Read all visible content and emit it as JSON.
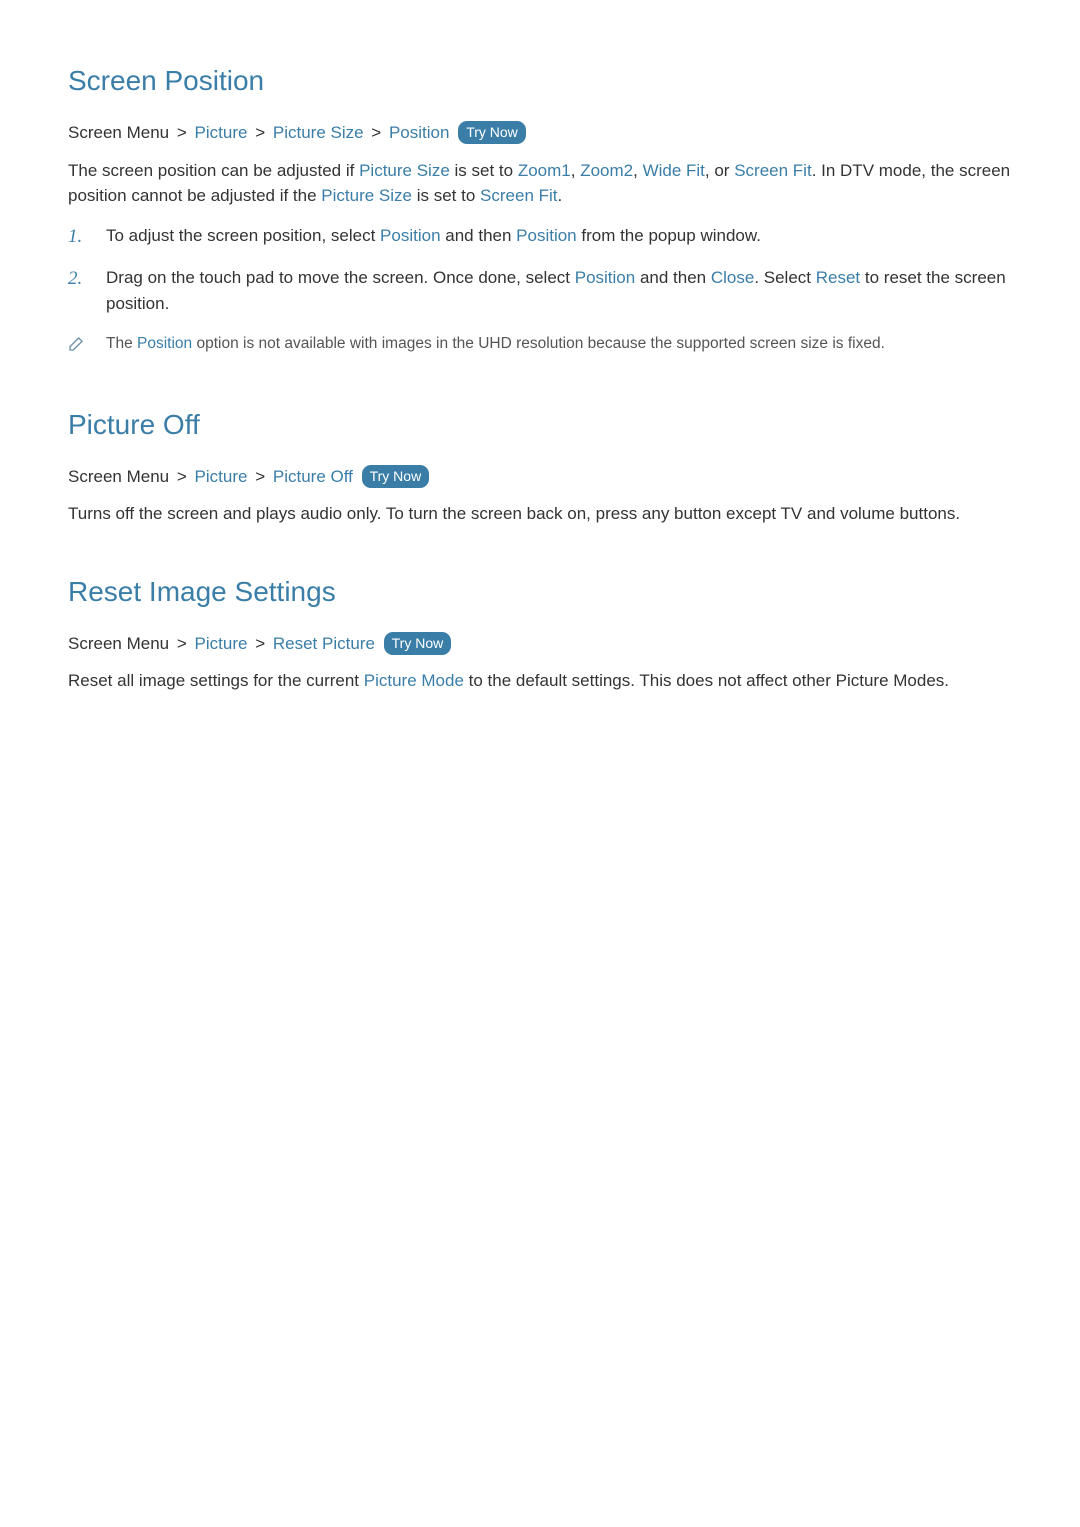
{
  "tryNowLabel": "Try Now",
  "sections": [
    {
      "title": "Screen Position",
      "breadcrumb": {
        "root": "Screen Menu",
        "parts": [
          "Picture",
          "Picture Size",
          "Position"
        ],
        "tryNow": true
      },
      "intro": {
        "segments": [
          {
            "t": "The screen position can be adjusted if "
          },
          {
            "t": "Picture Size",
            "hl": true
          },
          {
            "t": " is set to "
          },
          {
            "t": "Zoom1",
            "hl": true
          },
          {
            "t": ", "
          },
          {
            "t": "Zoom2",
            "hl": true
          },
          {
            "t": ", "
          },
          {
            "t": "Wide Fit",
            "hl": true
          },
          {
            "t": ", or "
          },
          {
            "t": "Screen Fit",
            "hl": true
          },
          {
            "t": ". In DTV mode, the screen position cannot be adjusted if the "
          },
          {
            "t": "Picture Size",
            "hl": true
          },
          {
            "t": " is set to "
          },
          {
            "t": "Screen Fit",
            "hl": true
          },
          {
            "t": "."
          }
        ]
      },
      "steps": [
        {
          "num": "1.",
          "segments": [
            {
              "t": "To adjust the screen position, select "
            },
            {
              "t": "Position",
              "hl": true
            },
            {
              "t": " and then "
            },
            {
              "t": "Position",
              "hl": true
            },
            {
              "t": " from the popup window."
            }
          ]
        },
        {
          "num": "2.",
          "segments": [
            {
              "t": "Drag on the touch pad to move the screen. Once done, select "
            },
            {
              "t": "Position",
              "hl": true
            },
            {
              "t": " and then "
            },
            {
              "t": "Close",
              "hl": true
            },
            {
              "t": ". Select "
            },
            {
              "t": "Reset",
              "hl": true
            },
            {
              "t": " to reset the screen position."
            }
          ]
        }
      ],
      "note": {
        "segments": [
          {
            "t": "The "
          },
          {
            "t": "Position",
            "hl": true
          },
          {
            "t": " option is not available with images in the UHD resolution because the supported screen size is fixed."
          }
        ]
      }
    },
    {
      "title": "Picture Off",
      "breadcrumb": {
        "root": "Screen Menu",
        "parts": [
          "Picture",
          "Picture Off"
        ],
        "tryNow": true
      },
      "intro": {
        "segments": [
          {
            "t": "Turns off the screen and plays audio only. To turn the screen back on, press any button except TV and volume buttons."
          }
        ]
      }
    },
    {
      "title": "Reset Image Settings",
      "breadcrumb": {
        "root": "Screen Menu",
        "parts": [
          "Picture",
          "Reset Picture"
        ],
        "tryNow": true
      },
      "intro": {
        "segments": [
          {
            "t": "Reset all image settings for the current "
          },
          {
            "t": "Picture Mode",
            "hl": true
          },
          {
            "t": " to the default settings. This does not affect other Picture Modes."
          }
        ]
      }
    }
  ]
}
